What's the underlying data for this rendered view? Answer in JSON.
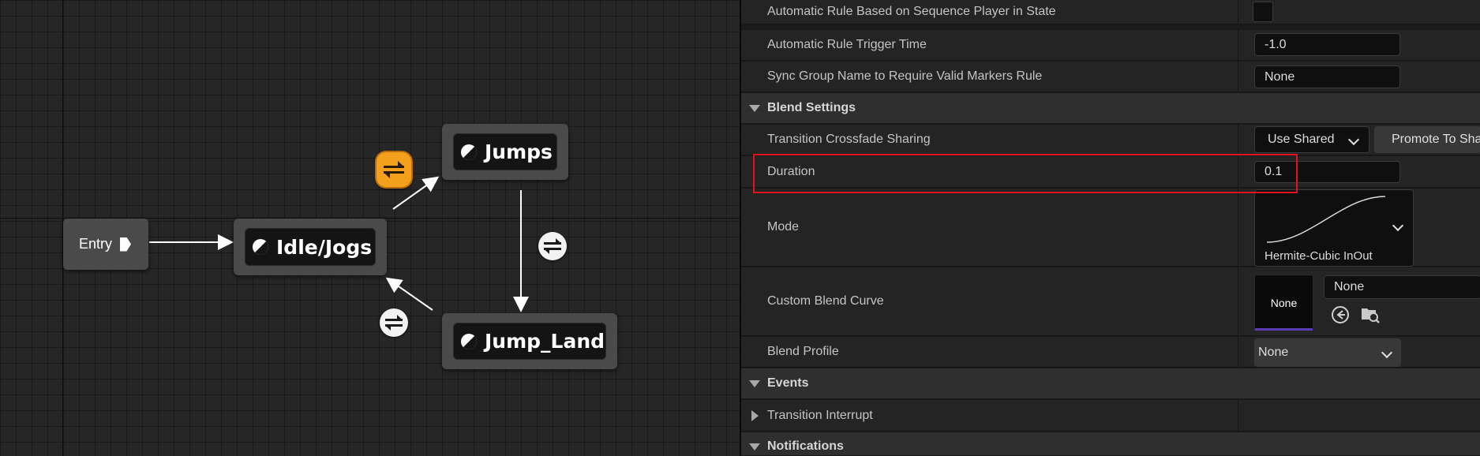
{
  "graph": {
    "entry_label": "Entry",
    "states": {
      "idle_jogs": "Idle/Jogs",
      "jumps": "Jumps",
      "jump_land": "Jump_Land"
    }
  },
  "details": {
    "rows": {
      "auto_rule": {
        "label": "Automatic Rule Based on Sequence Player in State",
        "checked": false
      },
      "trigger_time": {
        "label": "Automatic Rule Trigger Time",
        "value": "-1.0"
      },
      "sync_group": {
        "label": "Sync Group Name to Require Valid Markers Rule",
        "value": "None"
      }
    },
    "blend_settings": {
      "title": "Blend Settings",
      "crossfade": {
        "label": "Transition Crossfade Sharing",
        "value": "Use Shared",
        "promote_button": "Promote To Shared"
      },
      "duration": {
        "label": "Duration",
        "value": "0.1"
      },
      "mode": {
        "label": "Mode",
        "value": "Hermite-Cubic InOut"
      },
      "custom_curve": {
        "label": "Custom Blend Curve",
        "thumb_text": "None",
        "value": "None"
      },
      "blend_profile": {
        "label": "Blend Profile",
        "value": "None"
      }
    },
    "events": {
      "title": "Events",
      "transition_interrupt": "Transition Interrupt"
    },
    "notifications": {
      "title": "Notifications"
    }
  },
  "colors": {
    "highlight": "#e0151b",
    "transition_active": "#f3a11c",
    "curve_accent": "#5b3ab6"
  }
}
